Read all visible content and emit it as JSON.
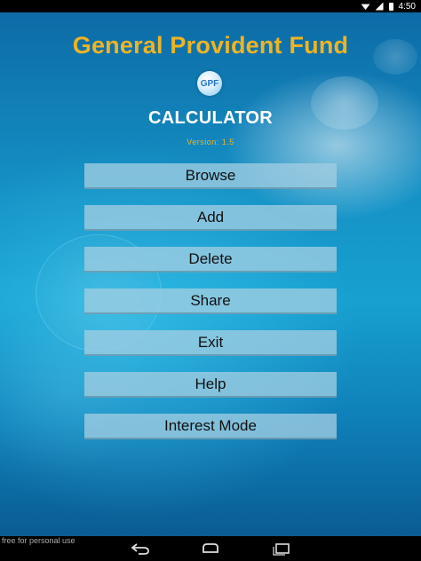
{
  "status": {
    "time": "4:50"
  },
  "app": {
    "title": "General Provident Fund",
    "logo_text": "GPF",
    "subtitle": "CALCULATOR",
    "version": "Version: 1.5"
  },
  "menu": {
    "items": [
      {
        "label": "Browse"
      },
      {
        "label": "Add"
      },
      {
        "label": "Delete"
      },
      {
        "label": "Share"
      },
      {
        "label": "Exit"
      },
      {
        "label": "Help"
      },
      {
        "label": "Interest Mode"
      }
    ]
  },
  "footer": {
    "watermark": "free for personal use"
  },
  "colors": {
    "title": "#f0b323",
    "button_bg": "#a0cde1",
    "background": "#1592c6"
  },
  "nav": {
    "icons": [
      "back-icon",
      "home-icon",
      "recent-apps-icon"
    ]
  }
}
